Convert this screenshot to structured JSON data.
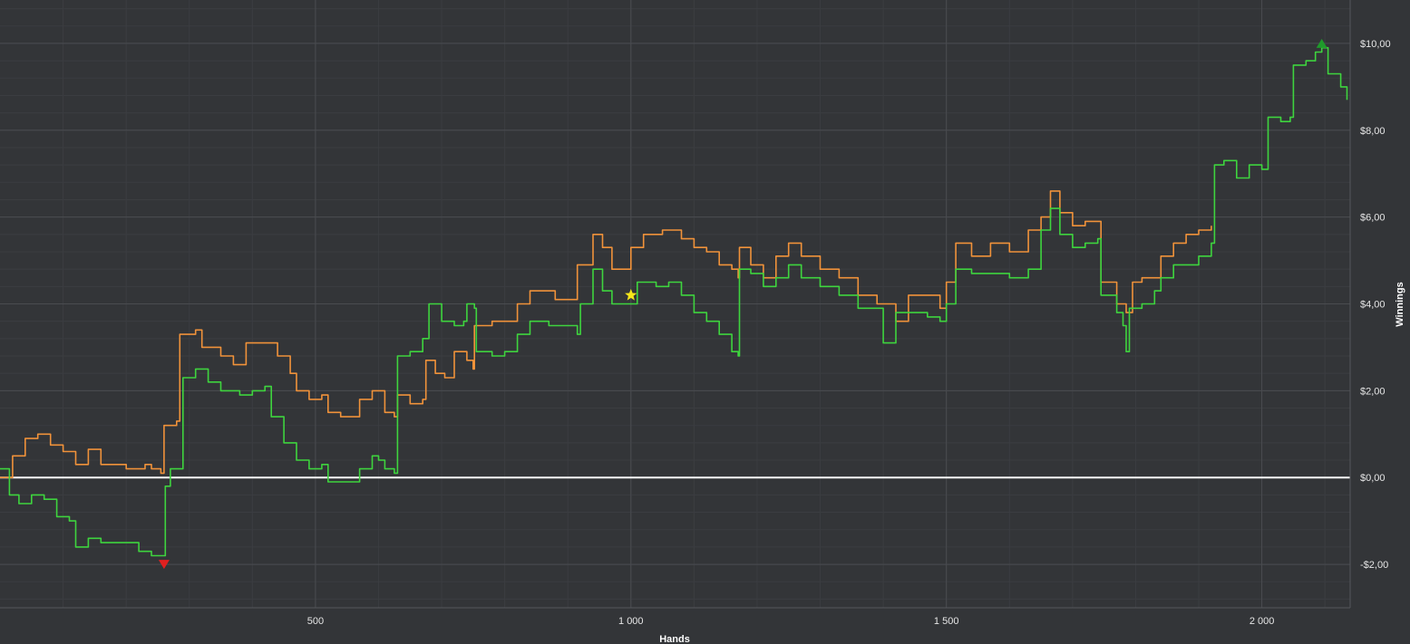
{
  "chart_data": {
    "type": "line",
    "xlabel": "Hands",
    "ylabel": "Winnings",
    "xlim": [
      0,
      2140
    ],
    "ylim": [
      -3.0,
      11.0
    ],
    "x_ticks": [
      {
        "value": 500,
        "label": "500"
      },
      {
        "value": 1000,
        "label": "1 000"
      },
      {
        "value": 1500,
        "label": "1 500"
      },
      {
        "value": 2000,
        "label": "2 000"
      }
    ],
    "y_ticks": [
      {
        "value": -2,
        "label": "-$2,00"
      },
      {
        "value": 0,
        "label": "$0,00"
      },
      {
        "value": 2,
        "label": "$2,00"
      },
      {
        "value": 4,
        "label": "$4,00"
      },
      {
        "value": 6,
        "label": "$6,00"
      },
      {
        "value": 8,
        "label": "$8,00"
      },
      {
        "value": 10,
        "label": "$10,00"
      }
    ],
    "grid": true,
    "zero_line": {
      "y": 0,
      "color": "#ffffff"
    },
    "series": [
      {
        "color": "#f0923a",
        "points": [
          [
            0,
            0.0
          ],
          [
            20,
            0.5
          ],
          [
            40,
            0.9
          ],
          [
            60,
            1.0
          ],
          [
            80,
            0.75
          ],
          [
            100,
            0.6
          ],
          [
            120,
            0.3
          ],
          [
            140,
            0.65
          ],
          [
            160,
            0.3
          ],
          [
            180,
            0.3
          ],
          [
            200,
            0.2
          ],
          [
            230,
            0.3
          ],
          [
            240,
            0.2
          ],
          [
            255,
            0.1
          ],
          [
            260,
            1.2
          ],
          [
            280,
            1.3
          ],
          [
            285,
            3.3
          ],
          [
            310,
            3.4
          ],
          [
            320,
            3.0
          ],
          [
            350,
            2.8
          ],
          [
            370,
            2.6
          ],
          [
            390,
            3.1
          ],
          [
            420,
            3.1
          ],
          [
            440,
            2.8
          ],
          [
            460,
            2.4
          ],
          [
            470,
            2.0
          ],
          [
            490,
            1.8
          ],
          [
            510,
            1.9
          ],
          [
            520,
            1.5
          ],
          [
            540,
            1.4
          ],
          [
            560,
            1.4
          ],
          [
            570,
            1.8
          ],
          [
            590,
            2.0
          ],
          [
            610,
            1.5
          ],
          [
            625,
            1.4
          ],
          [
            630,
            1.9
          ],
          [
            650,
            1.7
          ],
          [
            670,
            1.8
          ],
          [
            675,
            2.7
          ],
          [
            690,
            2.4
          ],
          [
            705,
            2.3
          ],
          [
            720,
            2.9
          ],
          [
            740,
            2.7
          ],
          [
            750,
            2.5
          ],
          [
            752,
            3.5
          ],
          [
            780,
            3.6
          ],
          [
            800,
            3.6
          ],
          [
            820,
            4.0
          ],
          [
            840,
            4.3
          ],
          [
            880,
            4.1
          ],
          [
            910,
            4.1
          ],
          [
            915,
            4.9
          ],
          [
            940,
            5.6
          ],
          [
            955,
            5.3
          ],
          [
            970,
            4.8
          ],
          [
            1000,
            5.3
          ],
          [
            1020,
            5.6
          ],
          [
            1050,
            5.7
          ],
          [
            1080,
            5.5
          ],
          [
            1100,
            5.3
          ],
          [
            1120,
            5.2
          ],
          [
            1140,
            4.9
          ],
          [
            1160,
            4.8
          ],
          [
            1170,
            4.6
          ],
          [
            1172,
            5.3
          ],
          [
            1190,
            4.9
          ],
          [
            1210,
            4.6
          ],
          [
            1230,
            5.1
          ],
          [
            1250,
            5.4
          ],
          [
            1270,
            5.1
          ],
          [
            1300,
            4.8
          ],
          [
            1330,
            4.6
          ],
          [
            1360,
            4.2
          ],
          [
            1390,
            4.0
          ],
          [
            1420,
            3.6
          ],
          [
            1440,
            4.2
          ],
          [
            1470,
            4.2
          ],
          [
            1490,
            3.9
          ],
          [
            1500,
            4.5
          ],
          [
            1515,
            5.4
          ],
          [
            1540,
            5.1
          ],
          [
            1570,
            5.4
          ],
          [
            1600,
            5.2
          ],
          [
            1630,
            5.7
          ],
          [
            1650,
            6.0
          ],
          [
            1665,
            6.6
          ],
          [
            1680,
            6.1
          ],
          [
            1700,
            5.8
          ],
          [
            1720,
            5.9
          ],
          [
            1740,
            5.9
          ],
          [
            1745,
            4.5
          ],
          [
            1770,
            4.0
          ],
          [
            1785,
            3.8
          ],
          [
            1795,
            4.5
          ],
          [
            1810,
            4.6
          ],
          [
            1830,
            4.6
          ],
          [
            1840,
            5.1
          ],
          [
            1860,
            5.4
          ],
          [
            1880,
            5.6
          ],
          [
            1900,
            5.7
          ],
          [
            1920,
            5.8
          ]
        ]
      },
      {
        "color": "#3ed43e",
        "points": [
          [
            0,
            0.2
          ],
          [
            10,
            0.2
          ],
          [
            15,
            -0.4
          ],
          [
            30,
            -0.6
          ],
          [
            50,
            -0.4
          ],
          [
            70,
            -0.5
          ],
          [
            90,
            -0.9
          ],
          [
            110,
            -1.0
          ],
          [
            120,
            -1.6
          ],
          [
            140,
            -1.4
          ],
          [
            160,
            -1.5
          ],
          [
            180,
            -1.5
          ],
          [
            200,
            -1.5
          ],
          [
            220,
            -1.7
          ],
          [
            235,
            -1.7
          ],
          [
            240,
            -1.8
          ],
          [
            245,
            -1.8
          ],
          [
            260,
            -1.8
          ],
          [
            262,
            -0.2
          ],
          [
            270,
            0.2
          ],
          [
            285,
            0.2
          ],
          [
            290,
            2.3
          ],
          [
            310,
            2.5
          ],
          [
            330,
            2.2
          ],
          [
            350,
            2.0
          ],
          [
            380,
            1.9
          ],
          [
            400,
            2.0
          ],
          [
            420,
            2.1
          ],
          [
            430,
            1.4
          ],
          [
            450,
            0.8
          ],
          [
            470,
            0.4
          ],
          [
            490,
            0.2
          ],
          [
            510,
            0.3
          ],
          [
            520,
            -0.1
          ],
          [
            540,
            -0.1
          ],
          [
            560,
            -0.1
          ],
          [
            570,
            0.2
          ],
          [
            590,
            0.5
          ],
          [
            600,
            0.4
          ],
          [
            610,
            0.2
          ],
          [
            625,
            0.1
          ],
          [
            630,
            2.8
          ],
          [
            650,
            2.9
          ],
          [
            660,
            2.9
          ],
          [
            670,
            3.2
          ],
          [
            680,
            4.0
          ],
          [
            700,
            3.6
          ],
          [
            720,
            3.5
          ],
          [
            735,
            3.6
          ],
          [
            740,
            4.0
          ],
          [
            752,
            3.9
          ],
          [
            755,
            2.9
          ],
          [
            780,
            2.8
          ],
          [
            800,
            2.9
          ],
          [
            820,
            3.3
          ],
          [
            840,
            3.6
          ],
          [
            870,
            3.5
          ],
          [
            900,
            3.5
          ],
          [
            915,
            3.3
          ],
          [
            920,
            4.0
          ],
          [
            940,
            4.8
          ],
          [
            955,
            4.3
          ],
          [
            970,
            4.0
          ],
          [
            990,
            4.0
          ],
          [
            1010,
            4.5
          ],
          [
            1040,
            4.4
          ],
          [
            1060,
            4.5
          ],
          [
            1080,
            4.2
          ],
          [
            1100,
            3.8
          ],
          [
            1120,
            3.6
          ],
          [
            1140,
            3.3
          ],
          [
            1160,
            2.9
          ],
          [
            1170,
            2.8
          ],
          [
            1172,
            4.8
          ],
          [
            1190,
            4.7
          ],
          [
            1210,
            4.4
          ],
          [
            1230,
            4.6
          ],
          [
            1250,
            4.9
          ],
          [
            1270,
            4.6
          ],
          [
            1300,
            4.4
          ],
          [
            1330,
            4.2
          ],
          [
            1360,
            3.9
          ],
          [
            1380,
            3.9
          ],
          [
            1400,
            3.1
          ],
          [
            1420,
            3.8
          ],
          [
            1440,
            3.8
          ],
          [
            1470,
            3.7
          ],
          [
            1490,
            3.6
          ],
          [
            1500,
            4.0
          ],
          [
            1515,
            4.8
          ],
          [
            1540,
            4.7
          ],
          [
            1570,
            4.7
          ],
          [
            1600,
            4.6
          ],
          [
            1630,
            4.8
          ],
          [
            1650,
            5.7
          ],
          [
            1665,
            6.2
          ],
          [
            1680,
            5.6
          ],
          [
            1700,
            5.3
          ],
          [
            1720,
            5.4
          ],
          [
            1740,
            5.5
          ],
          [
            1745,
            4.2
          ],
          [
            1770,
            3.8
          ],
          [
            1780,
            3.5
          ],
          [
            1785,
            2.9
          ],
          [
            1790,
            3.9
          ],
          [
            1810,
            4.0
          ],
          [
            1825,
            4.0
          ],
          [
            1830,
            4.3
          ],
          [
            1840,
            4.6
          ],
          [
            1860,
            4.9
          ],
          [
            1880,
            4.9
          ],
          [
            1900,
            5.1
          ],
          [
            1920,
            5.4
          ],
          [
            1925,
            7.2
          ],
          [
            1940,
            7.3
          ],
          [
            1960,
            6.9
          ],
          [
            1980,
            7.2
          ],
          [
            2000,
            7.1
          ],
          [
            2010,
            8.3
          ],
          [
            2030,
            8.2
          ],
          [
            2045,
            8.3
          ],
          [
            2050,
            9.5
          ],
          [
            2070,
            9.6
          ],
          [
            2085,
            9.8
          ],
          [
            2095,
            9.9
          ],
          [
            2105,
            9.3
          ],
          [
            2125,
            9.0
          ],
          [
            2135,
            8.7
          ]
        ]
      }
    ],
    "markers": [
      {
        "shape": "triangle-down",
        "x": 260,
        "y": -2.0,
        "color": "#e02020"
      },
      {
        "shape": "star",
        "x": 1000,
        "y": 4.2,
        "color": "#f5e61a"
      },
      {
        "shape": "triangle-up",
        "x": 2095,
        "y": 10.0,
        "color": "#1f9a2b"
      }
    ],
    "colors": {
      "background": "#333538",
      "grid": "#4a4c50",
      "minor_grid": "#3b3d41",
      "axis_text": "#e6e6e6"
    }
  }
}
